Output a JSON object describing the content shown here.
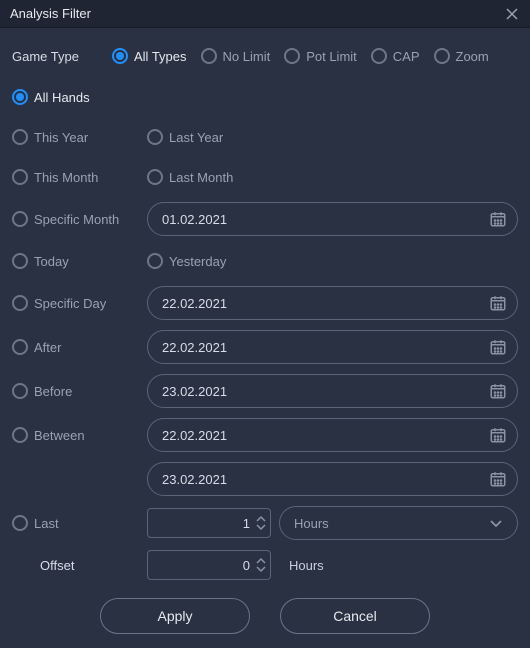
{
  "window": {
    "title": "Analysis Filter"
  },
  "gameType": {
    "label": "Game Type",
    "options": {
      "allTypes": "All Types",
      "noLimit": "No Limit",
      "potLimit": "Pot Limit",
      "cap": "CAP",
      "zoom": "Zoom"
    },
    "selected": "allTypes"
  },
  "timeFilter": {
    "allHands": "All Hands",
    "thisYear": "This Year",
    "lastYear": "Last Year",
    "thisMonth": "This Month",
    "lastMonth": "Last Month",
    "specificMonth": "Specific Month",
    "today": "Today",
    "yesterday": "Yesterday",
    "specificDay": "Specific Day",
    "after": "After",
    "before": "Before",
    "between": "Between",
    "last": "Last",
    "selected": "allHands"
  },
  "values": {
    "specificMonthDate": "01.02.2021",
    "specificDayDate": "22.02.2021",
    "afterDate": "22.02.2021",
    "beforeDate": "23.02.2021",
    "betweenStart": "22.02.2021",
    "betweenEnd": "23.02.2021",
    "lastAmount": "1",
    "lastUnit": "Hours",
    "offsetLabel": "Offset",
    "offsetValue": "0",
    "offsetUnit": "Hours"
  },
  "buttons": {
    "apply": "Apply",
    "cancel": "Cancel"
  }
}
